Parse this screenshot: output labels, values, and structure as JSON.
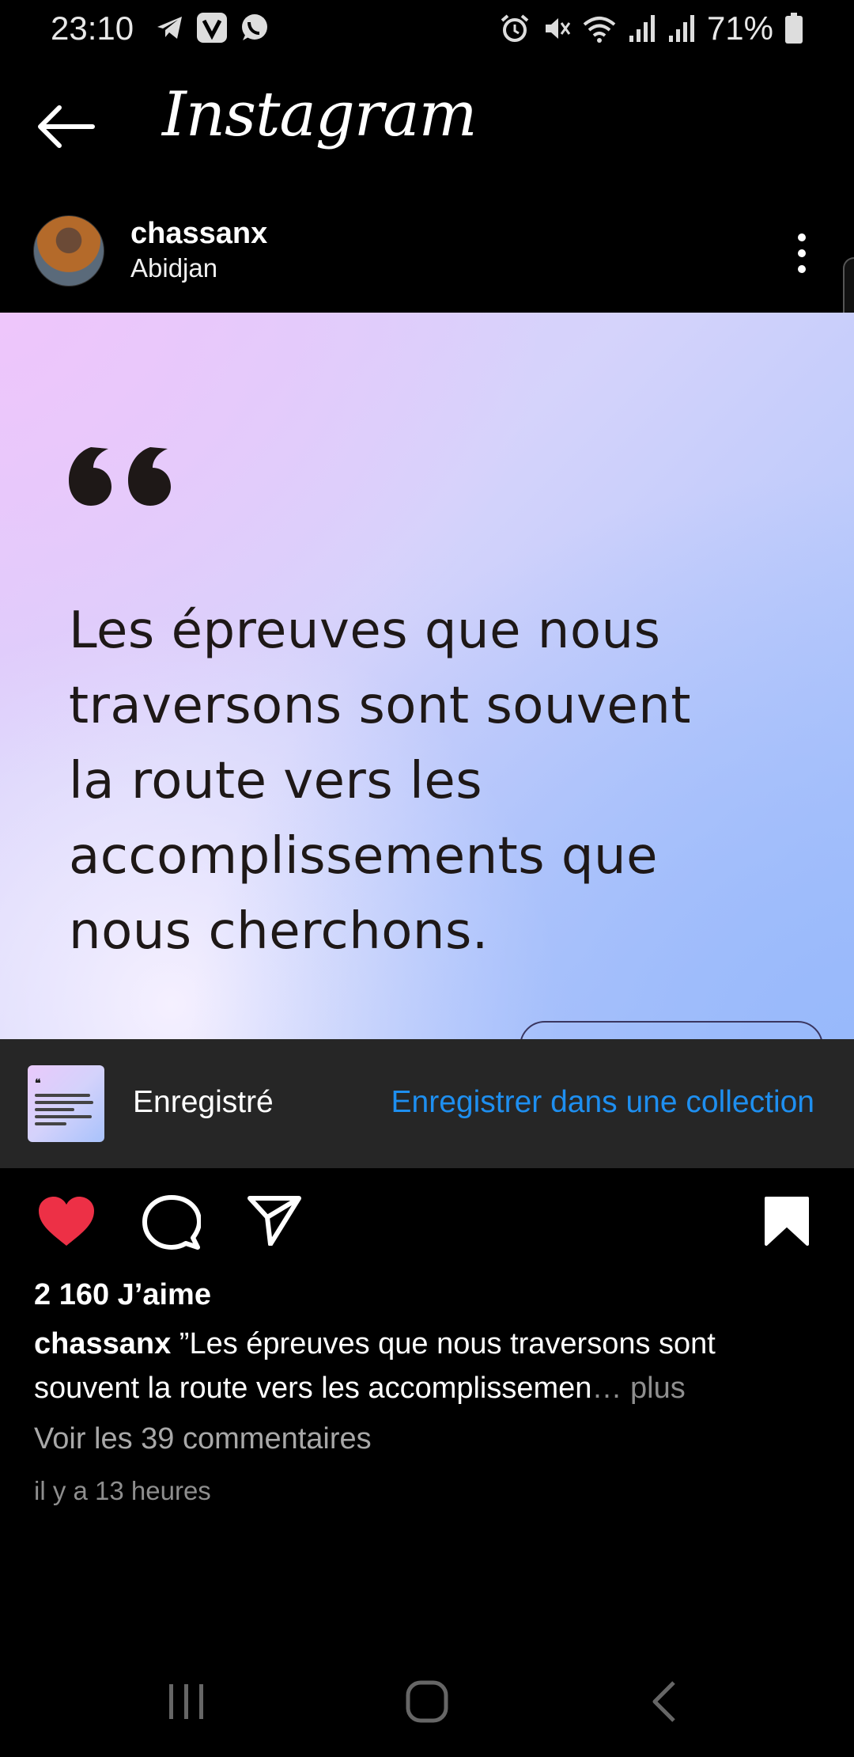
{
  "status": {
    "time": "23:10",
    "battery": "71%"
  },
  "topbar": {
    "logo": "Instagram"
  },
  "post": {
    "username": "chassanx",
    "location": "Abidjan",
    "quote_lines": [
      "Les épreuves que nous",
      "traversons sont souvent",
      "la route vers les",
      "accomplissements que",
      "nous cherchons."
    ]
  },
  "saved_bar": {
    "label": "Enregistré",
    "action": "Enregistrer dans une collection"
  },
  "engagement": {
    "likes": "2 160 J’aime",
    "caption_user": "chassanx",
    "caption_text": " ”Les épreuves que nous traversons sont souvent la route vers les accomplissemen",
    "caption_more": "… plus",
    "comments": "Voir les 39 commentaires",
    "time_ago": "il y a 13 heures"
  },
  "colors": {
    "like_red": "#ed3046",
    "link_blue": "#1e8ff0",
    "saved_bar_bg": "#262626"
  },
  "icons": [
    "telegram-icon",
    "viber-icon",
    "whatsapp-icon",
    "alarm-icon",
    "mute-icon",
    "wifi-icon",
    "signal-icon",
    "battery-icon",
    "back-arrow-icon",
    "more-vertical-icon",
    "quote-icon",
    "heart-icon",
    "comment-icon",
    "share-icon",
    "bookmark-icon",
    "recent-apps-icon",
    "home-icon",
    "nav-back-icon"
  ]
}
